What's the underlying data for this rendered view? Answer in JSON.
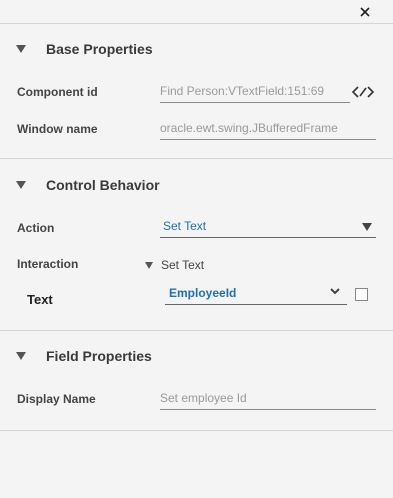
{
  "window": {
    "close_label": "close"
  },
  "base_properties": {
    "title": "Base Properties",
    "component_id_label": "Component id",
    "component_id_value": "Find Person:VTextField:151:69",
    "window_name_label": "Window name",
    "window_name_value": "oracle.ewt.swing.JBufferedFrame"
  },
  "control_behavior": {
    "title": "Control Behavior",
    "action_label": "Action",
    "action_value": "Set Text",
    "interaction_label": "Interaction",
    "interaction_value": "Set Text",
    "text_label": "Text",
    "text_value": "EmployeeId"
  },
  "field_properties": {
    "title": "Field Properties",
    "display_name_label": "Display Name",
    "display_name_placeholder": "Set employee Id"
  },
  "colors": {
    "accent": "#1f6fb2",
    "background": "#f4f4f4",
    "divider": "#d6d6d6"
  },
  "icons": [
    "close-icon",
    "caret-down-icon",
    "edit-code-icon",
    "chevron-down-icon",
    "checkbox"
  ]
}
